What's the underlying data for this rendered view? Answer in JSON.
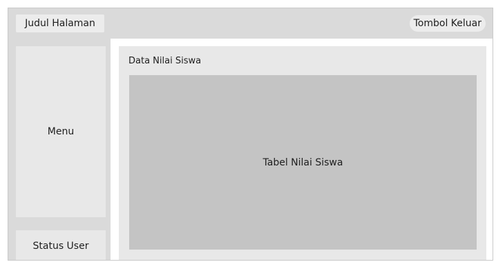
{
  "header": {
    "title": "Judul Halaman",
    "logout_label": "Tombol Keluar"
  },
  "sidebar": {
    "menu_label": "Menu",
    "status_label": "Status User"
  },
  "main": {
    "section_title": "Data Nilai Siswa",
    "table_placeholder": "Tabel Nilai Siswa"
  },
  "colors": {
    "frame_bg": "#dadada",
    "panel_bg": "#e8e8e8",
    "table_bg": "#c4c4c4",
    "main_bg": "#ffffff"
  }
}
